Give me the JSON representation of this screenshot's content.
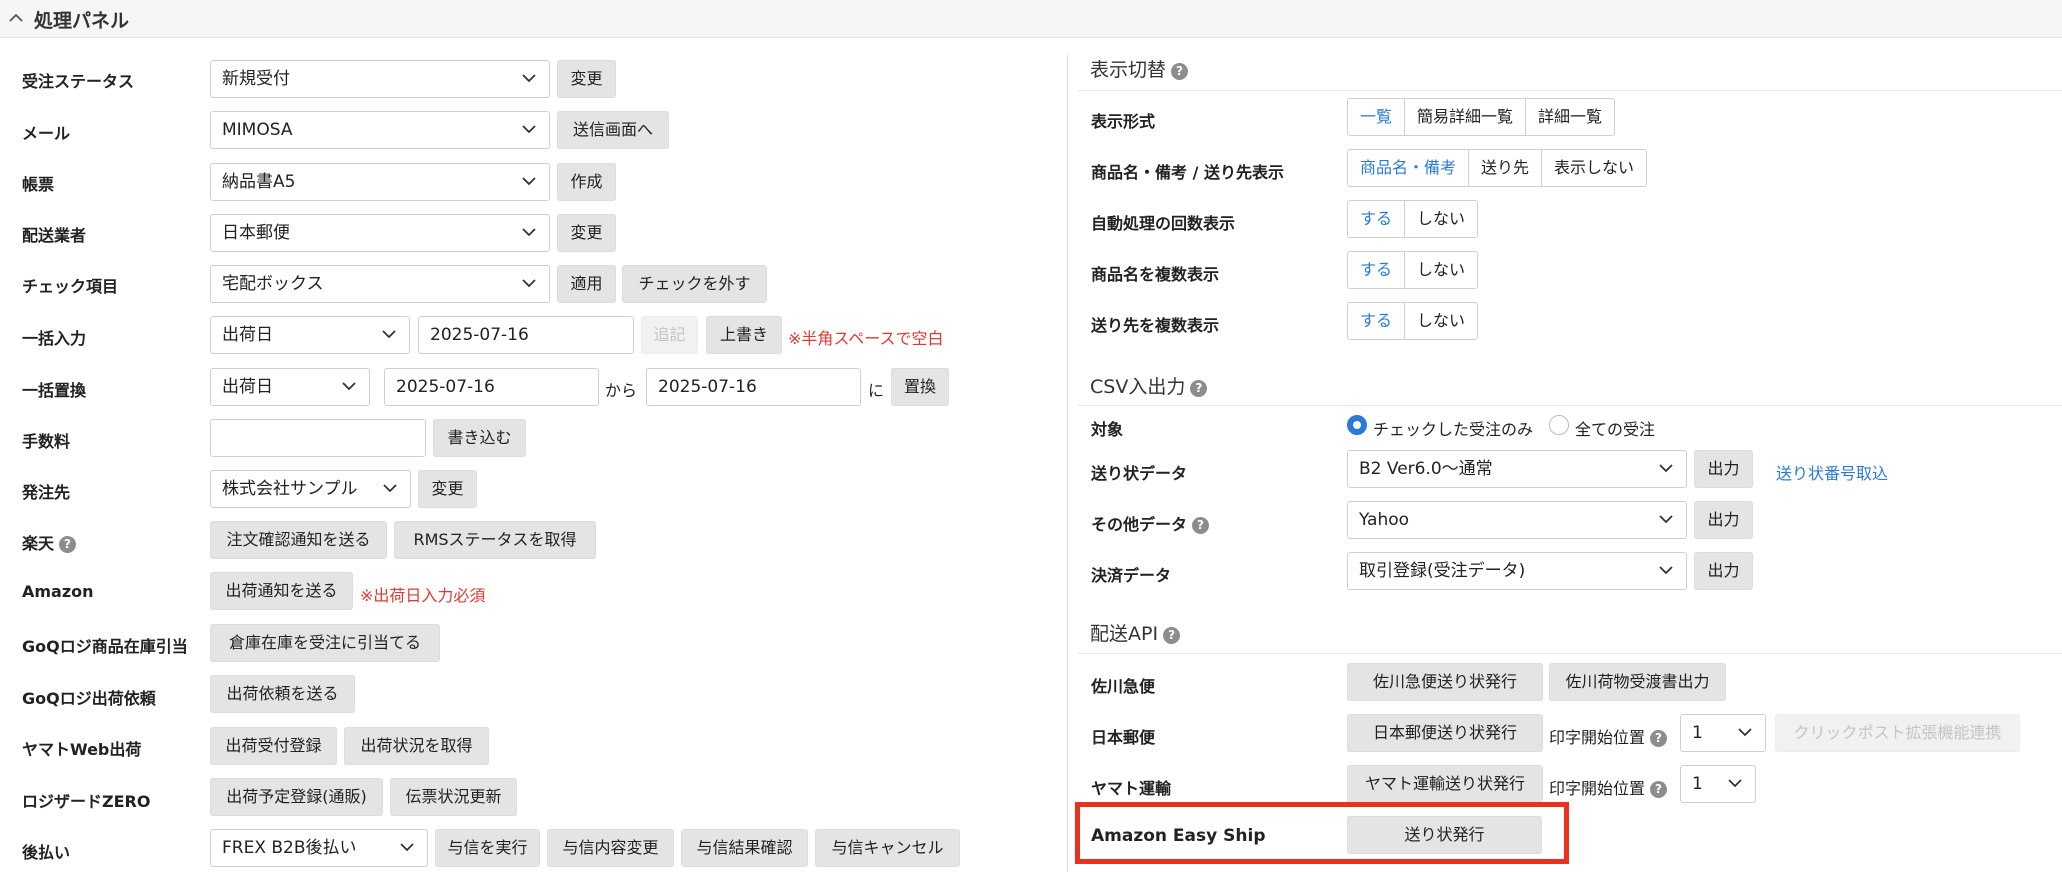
{
  "panel": {
    "title": "処理パネル"
  },
  "left": {
    "order_status": {
      "label": "受注ステータス",
      "value": "新規受付",
      "button": "変更"
    },
    "mail": {
      "label": "メール",
      "value": "MIMOSA",
      "button": "送信画面へ"
    },
    "form": {
      "label": "帳票",
      "value": "納品書A5",
      "button": "作成"
    },
    "carrier": {
      "label": "配送業者",
      "value": "日本郵便",
      "button": "変更"
    },
    "check_item": {
      "label": "チェック項目",
      "value": "宅配ボックス",
      "apply": "適用",
      "uncheck": "チェックを外す"
    },
    "bulk_input": {
      "label": "一括入力",
      "field": "出荷日",
      "date": "2025-07-16",
      "append": "追記",
      "overwrite": "上書き",
      "note": "※半角スペースで空白"
    },
    "bulk_replace": {
      "label": "一括置換",
      "field": "出荷日",
      "from": "2025-07-16",
      "kara": "から",
      "to": "2025-07-16",
      "ni": "に",
      "button": "置換"
    },
    "fee": {
      "label": "手数料",
      "value": "",
      "button": "書き込む"
    },
    "supplier": {
      "label": "発注先",
      "value": "株式会社サンプル",
      "button": "変更"
    },
    "rakuten": {
      "label": "楽天",
      "btn1": "注文確認通知を送る",
      "btn2": "RMSステータスを取得"
    },
    "amazon": {
      "label": "Amazon",
      "button": "出荷通知を送る",
      "note": "※出荷日入力必須"
    },
    "goq_stock": {
      "label": "GoQロジ商品在庫引当",
      "button": "倉庫在庫を受注に引当てる"
    },
    "goq_ship": {
      "label": "GoQロジ出荷依頼",
      "button": "出荷依頼を送る"
    },
    "yamato_web": {
      "label": "ヤマトWeb出荷",
      "btn1": "出荷受付登録",
      "btn2": "出荷状況を取得"
    },
    "logizard": {
      "label": "ロジザードZERO",
      "btn1": "出荷予定登録(通販)",
      "btn2": "伝票状況更新"
    },
    "deferred": {
      "label": "後払い",
      "value": "FREX B2B後払い",
      "btn1": "与信を実行",
      "btn2": "与信内容変更",
      "btn3": "与信結果確認",
      "btn4": "与信キャンセル"
    }
  },
  "right": {
    "display": {
      "title": "表示切替",
      "format": {
        "label": "表示形式",
        "options": [
          "一覧",
          "簡易詳細一覧",
          "詳細一覧"
        ]
      },
      "product": {
        "label": "商品名・備考 / 送り先表示",
        "options": [
          "商品名・備考",
          "送り先",
          "表示しない"
        ]
      },
      "auto_count": {
        "label": "自動処理の回数表示",
        "options": [
          "する",
          "しない"
        ]
      },
      "multi_product": {
        "label": "商品名を複数表示",
        "options": [
          "する",
          "しない"
        ]
      },
      "multi_dest": {
        "label": "送り先を複数表示",
        "options": [
          "する",
          "しない"
        ]
      }
    },
    "csv": {
      "title": "CSV入出力",
      "target": {
        "label": "対象",
        "opt1": "チェックした受注のみ",
        "opt2": "全ての受注"
      },
      "waybill": {
        "label": "送り状データ",
        "value": "B2 Ver6.0〜通常",
        "button": "出力",
        "link": "送り状番号取込"
      },
      "other": {
        "label": "その他データ",
        "value": "Yahoo",
        "button": "出力"
      },
      "payment": {
        "label": "決済データ",
        "value": "取引登録(受注データ)",
        "button": "出力"
      }
    },
    "api": {
      "title": "配送API",
      "sagawa": {
        "label": "佐川急便",
        "btn1": "佐川急便送り状発行",
        "btn2": "佐川荷物受渡書出力"
      },
      "japanpost": {
        "label": "日本郵便",
        "button": "日本郵便送り状発行",
        "pos_label": "印字開始位置",
        "pos_value": "1",
        "clickpost": "クリックポスト拡張機能連携"
      },
      "yamato": {
        "label": "ヤマト運輸",
        "button": "ヤマト運輸送り状発行",
        "pos_label": "印字開始位置",
        "pos_value": "1"
      },
      "easyship": {
        "label": "Amazon Easy Ship",
        "button": "送り状発行"
      }
    }
  },
  "colors": {
    "accent": "#2a7ad9",
    "warning": "#e0392f",
    "highlight": "#e8321f"
  }
}
